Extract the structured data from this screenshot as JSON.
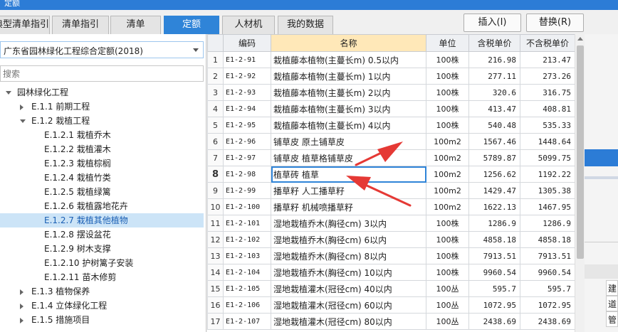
{
  "window": {
    "title": "定额"
  },
  "tabs": [
    {
      "label": "典型清单指引",
      "active": false
    },
    {
      "label": "清单指引",
      "active": false
    },
    {
      "label": "清单",
      "active": false
    },
    {
      "label": "定额",
      "active": true
    },
    {
      "label": "人材机",
      "active": false
    },
    {
      "label": "我的数据",
      "active": false
    }
  ],
  "toolbar": {
    "insert_label": "插入(I)",
    "replace_label": "替换(R)"
  },
  "library": {
    "selected": "广东省园林绿化工程综合定额(2018)"
  },
  "search": {
    "placeholder": "搜索"
  },
  "tree": [
    {
      "label": "园林绿化工程",
      "level": 0,
      "expander": "open"
    },
    {
      "label": "E.1.1 前期工程",
      "level": 1,
      "expander": "closed"
    },
    {
      "label": "E.1.2 栽植工程",
      "level": 1,
      "expander": "open"
    },
    {
      "label": "E.1.2.1 栽植乔木",
      "level": 2,
      "expander": "none"
    },
    {
      "label": "E.1.2.2 栽植灌木",
      "level": 2,
      "expander": "none"
    },
    {
      "label": "E.1.2.3 栽植棕榈",
      "level": 2,
      "expander": "none"
    },
    {
      "label": "E.1.2.4 栽植竹类",
      "level": 2,
      "expander": "none"
    },
    {
      "label": "E.1.2.5 栽植绿篱",
      "level": 2,
      "expander": "none"
    },
    {
      "label": "E.1.2.6 栽植露地花卉",
      "level": 2,
      "expander": "none"
    },
    {
      "label": "E.1.2.7 栽植其他植物",
      "level": 2,
      "expander": "none",
      "selected": true
    },
    {
      "label": "E.1.2.8 摆设盆花",
      "level": 2,
      "expander": "none"
    },
    {
      "label": "E.1.2.9 树木支撑",
      "level": 2,
      "expander": "none"
    },
    {
      "label": "E.1.2.10 护树篱子安装",
      "level": 2,
      "expander": "none"
    },
    {
      "label": "E.1.2.11 苗木修剪",
      "level": 2,
      "expander": "none"
    },
    {
      "label": "E.1.3 植物保养",
      "level": 1,
      "expander": "closed"
    },
    {
      "label": "E.1.4 立体绿化工程",
      "level": 1,
      "expander": "closed"
    },
    {
      "label": "E.1.5 措施项目",
      "level": 1,
      "expander": "closed"
    }
  ],
  "grid": {
    "columns": [
      "编码",
      "名称",
      "单位",
      "含税单价",
      "不含税单价"
    ],
    "rows": [
      {
        "no": "1",
        "code": "E1-2-91",
        "name": "栽植藤本植物(主蔓长m) 0.5以内",
        "unit": "100株",
        "price_tax": "216.98",
        "price_notax": "213.47"
      },
      {
        "no": "2",
        "code": "E1-2-92",
        "name": "栽植藤本植物(主蔓长m) 1以内",
        "unit": "100株",
        "price_tax": "277.11",
        "price_notax": "273.26"
      },
      {
        "no": "3",
        "code": "E1-2-93",
        "name": "栽植藤本植物(主蔓长m) 2以内",
        "unit": "100株",
        "price_tax": "320.6",
        "price_notax": "316.75"
      },
      {
        "no": "4",
        "code": "E1-2-94",
        "name": "栽植藤本植物(主蔓长m) 3以内",
        "unit": "100株",
        "price_tax": "413.47",
        "price_notax": "408.81"
      },
      {
        "no": "5",
        "code": "E1-2-95",
        "name": "栽植藤本植物(主蔓长m) 4以内",
        "unit": "100株",
        "price_tax": "540.48",
        "price_notax": "535.33"
      },
      {
        "no": "6",
        "code": "E1-2-96",
        "name": "铺草皮 原土铺草皮",
        "unit": "100m2",
        "price_tax": "1567.46",
        "price_notax": "1448.64"
      },
      {
        "no": "7",
        "code": "E1-2-97",
        "name": "铺草皮 植草格铺草皮",
        "unit": "100m2",
        "price_tax": "5789.87",
        "price_notax": "5099.75"
      },
      {
        "no": "8",
        "code": "E1-2-98",
        "name": "植草砖 植草",
        "unit": "100m2",
        "price_tax": "1256.62",
        "price_notax": "1192.22",
        "selected": true
      },
      {
        "no": "9",
        "code": "E1-2-99",
        "name": "播草籽 人工播草籽",
        "unit": "100m2",
        "price_tax": "1429.47",
        "price_notax": "1305.38"
      },
      {
        "no": "10",
        "code": "E1-2-100",
        "name": "播草籽 机械喷播草籽",
        "unit": "100m2",
        "price_tax": "1622.13",
        "price_notax": "1467.95"
      },
      {
        "no": "11",
        "code": "E1-2-101",
        "name": "湿地栽植乔木(胸径cm) 3以内",
        "unit": "100株",
        "price_tax": "1286.9",
        "price_notax": "1286.9"
      },
      {
        "no": "12",
        "code": "E1-2-102",
        "name": "湿地栽植乔木(胸径cm) 6以内",
        "unit": "100株",
        "price_tax": "4858.18",
        "price_notax": "4858.18"
      },
      {
        "no": "13",
        "code": "E1-2-103",
        "name": "湿地栽植乔木(胸径cm) 8以内",
        "unit": "100株",
        "price_tax": "7913.51",
        "price_notax": "7913.51"
      },
      {
        "no": "14",
        "code": "E1-2-104",
        "name": "湿地栽植乔木(胸径cm) 10以内",
        "unit": "100株",
        "price_tax": "9960.54",
        "price_notax": "9960.54"
      },
      {
        "no": "15",
        "code": "E1-2-105",
        "name": "湿地栽植灌木(冠径cm) 40以内",
        "unit": "100丛",
        "price_tax": "595.7",
        "price_notax": "595.7"
      },
      {
        "no": "16",
        "code": "E1-2-106",
        "name": "湿地栽植灌木(冠径cm) 60以内",
        "unit": "100丛",
        "price_tax": "1072.95",
        "price_notax": "1072.95"
      },
      {
        "no": "17",
        "code": "E1-2-107",
        "name": "湿地栽植灌木(冠径cm) 80以内",
        "unit": "100丛",
        "price_tax": "2438.69",
        "price_notax": "2438.69"
      }
    ]
  },
  "right_strip": {
    "cells": [
      "建",
      "道",
      "管"
    ]
  },
  "colors": {
    "accent": "#2f84d8",
    "annotation": "#e53935",
    "name_header": "#ffe8b8",
    "tree_selected": "#cce4f7"
  }
}
